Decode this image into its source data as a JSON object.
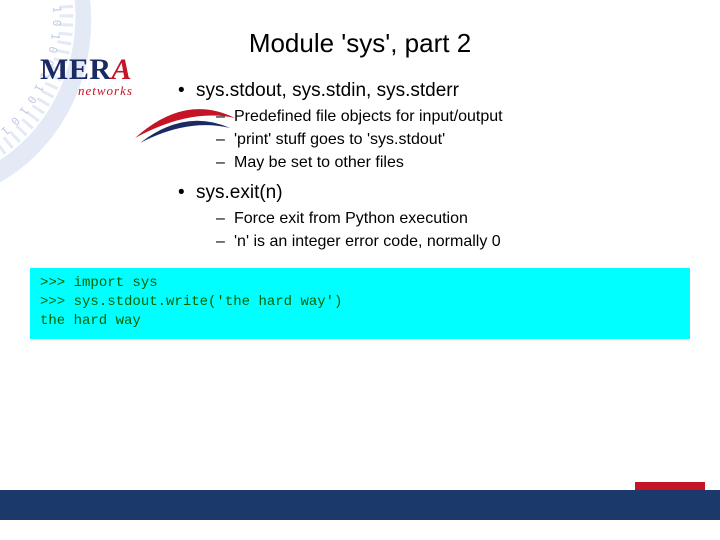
{
  "logo": {
    "text_left": "MER",
    "text_a": "A",
    "sub": "networks"
  },
  "title": "Module 'sys', part 2",
  "bullets": [
    {
      "text": "sys.stdout, sys.stdin, sys.stderr",
      "sub": [
        "Predefined file objects for input/output",
        "'print' stuff goes to 'sys.stdout'",
        "May be set to other files"
      ]
    },
    {
      "text": "sys.exit(n)",
      "sub": [
        "Force exit from Python execution",
        "'n' is an integer error code, normally 0"
      ]
    }
  ],
  "code": {
    "line1_prompt": ">>> ",
    "line1_cmd": "import sys",
    "line2_prompt": ">>> ",
    "line2_cmd": "sys.stdout.write('the hard way')",
    "line3_out": "the hard way"
  }
}
